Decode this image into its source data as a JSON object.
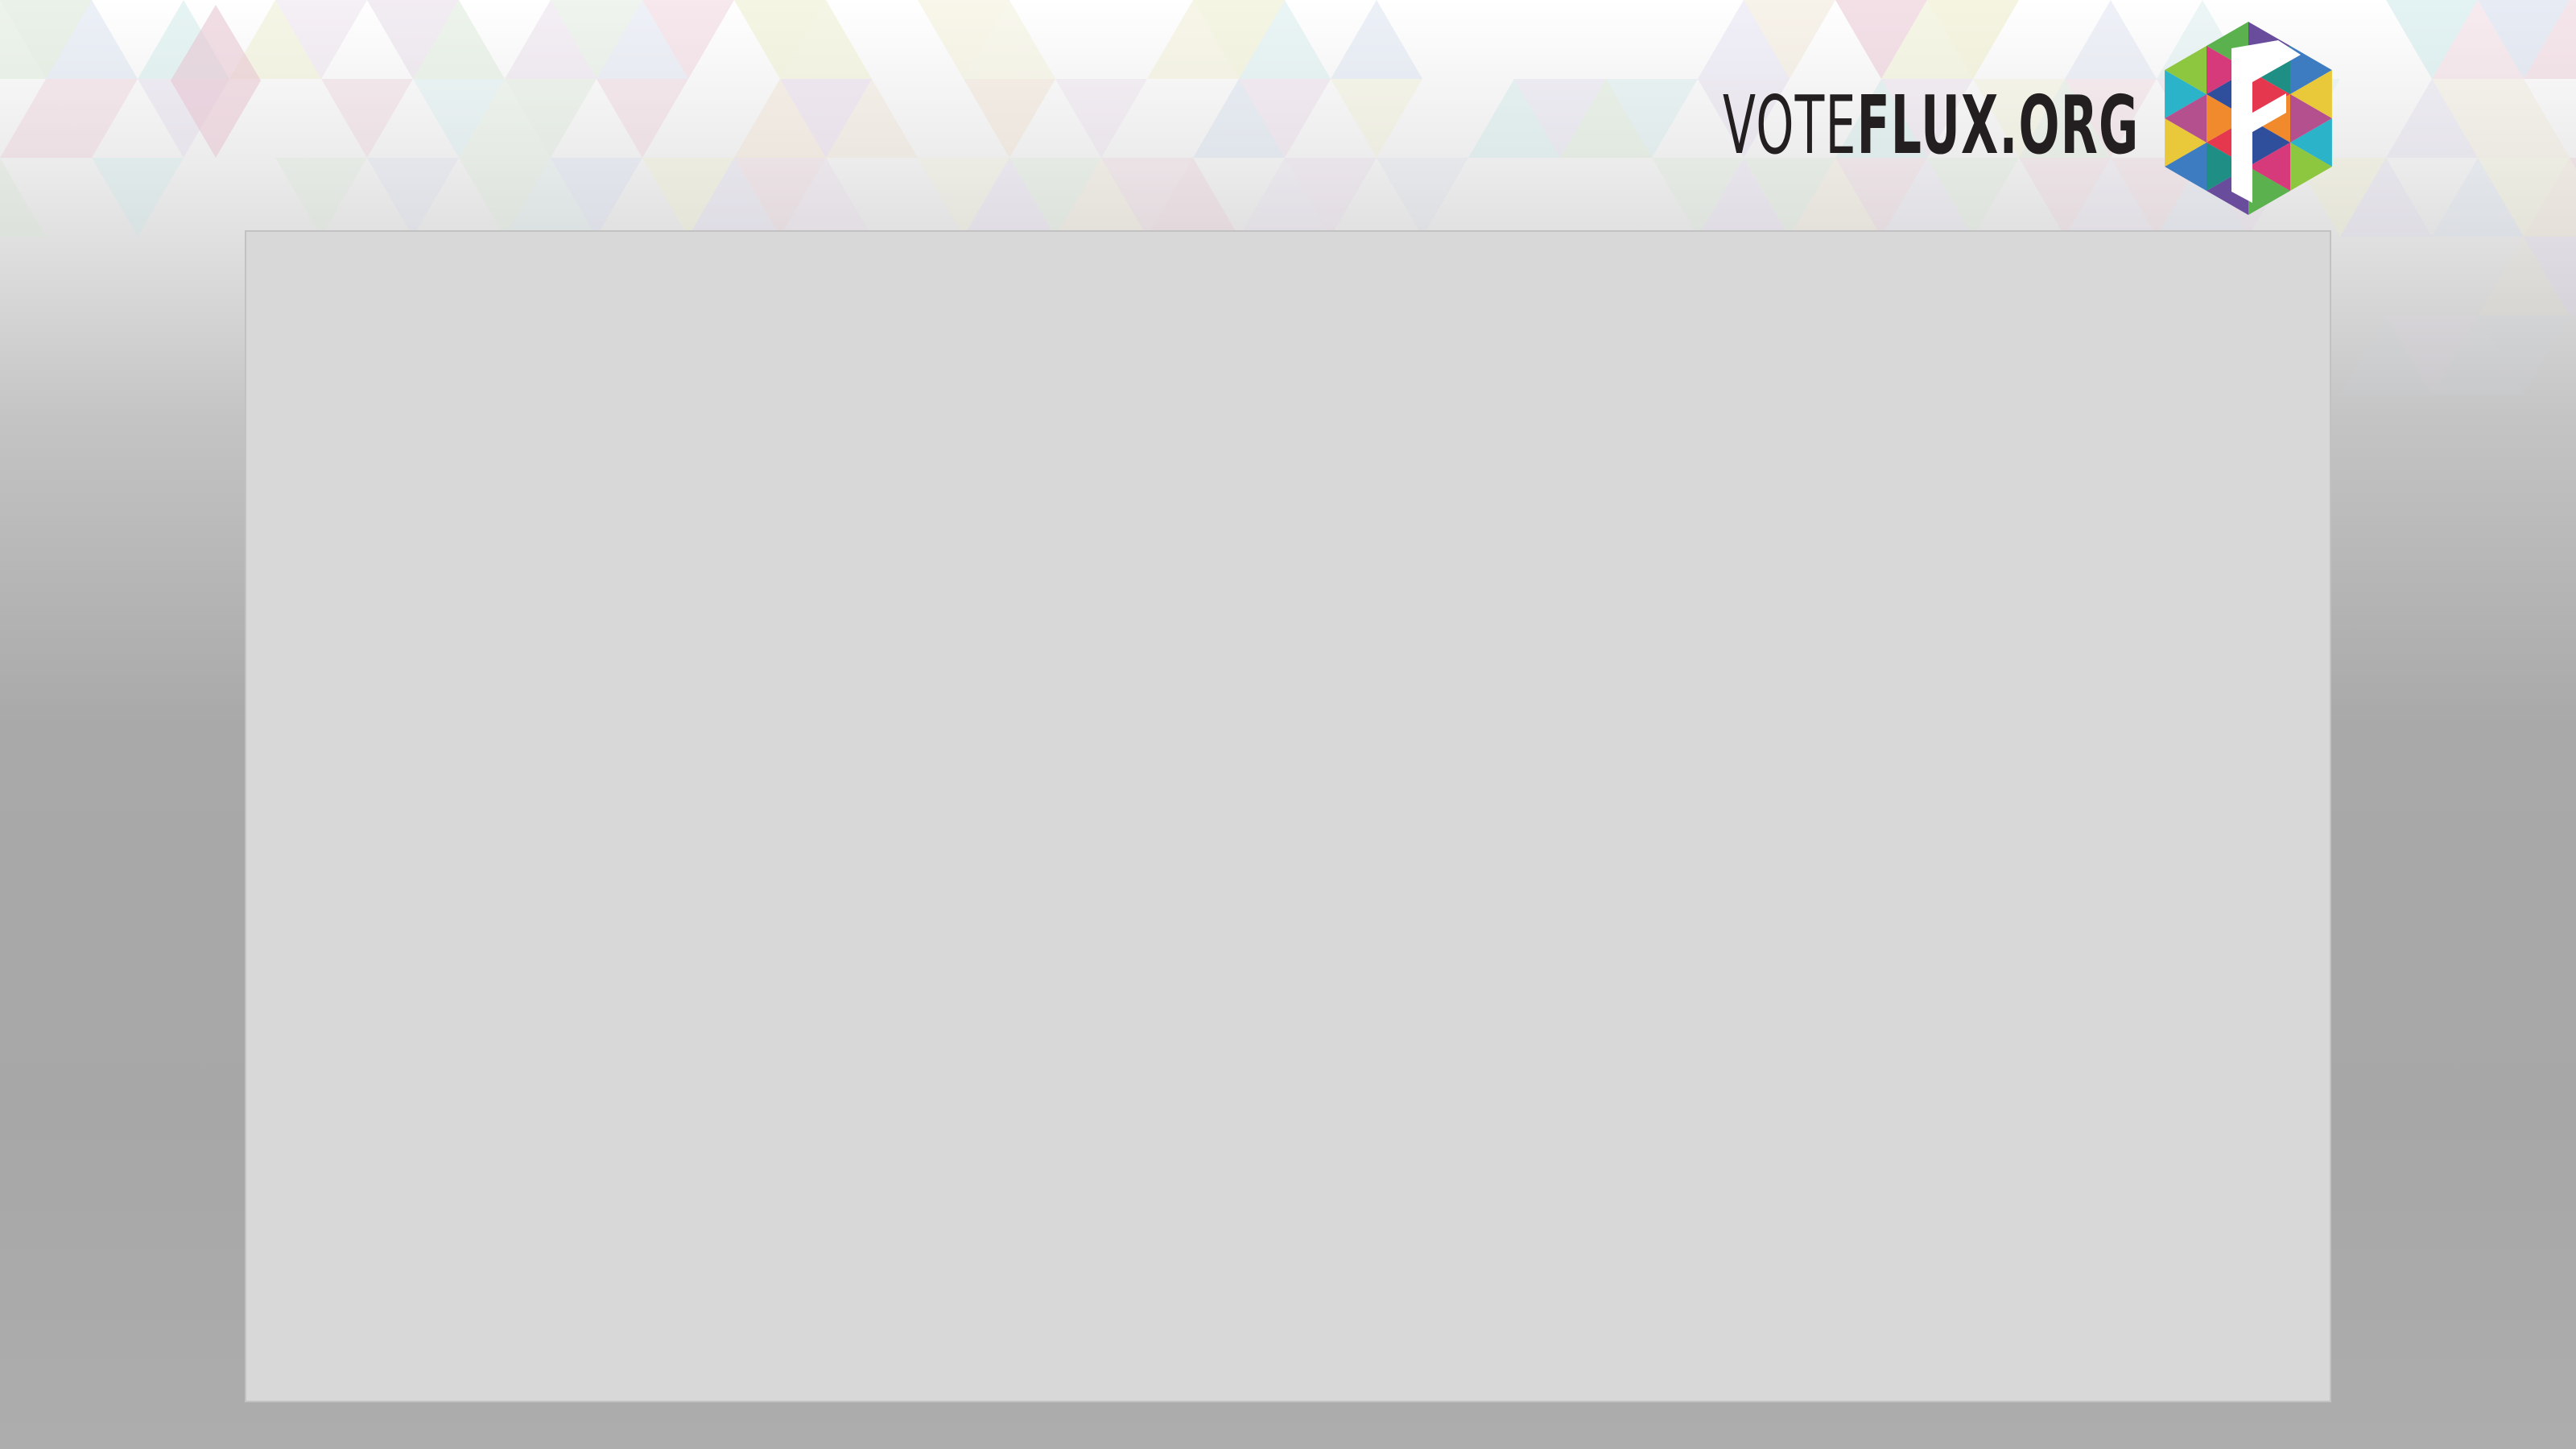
{
  "logo": {
    "text_light": "VOTE",
    "text_bold": "FLUX.ORG",
    "text_color": "#231f20",
    "mark_icon": "flux-hexagon-logo-icon"
  },
  "background": {
    "top_color": "#ffffff",
    "bottom_color": "#a9a9a9",
    "pattern": "pastel-triangle-mosaic"
  },
  "content_panel": {
    "fill_color": "#d8d8d8",
    "text": ""
  }
}
